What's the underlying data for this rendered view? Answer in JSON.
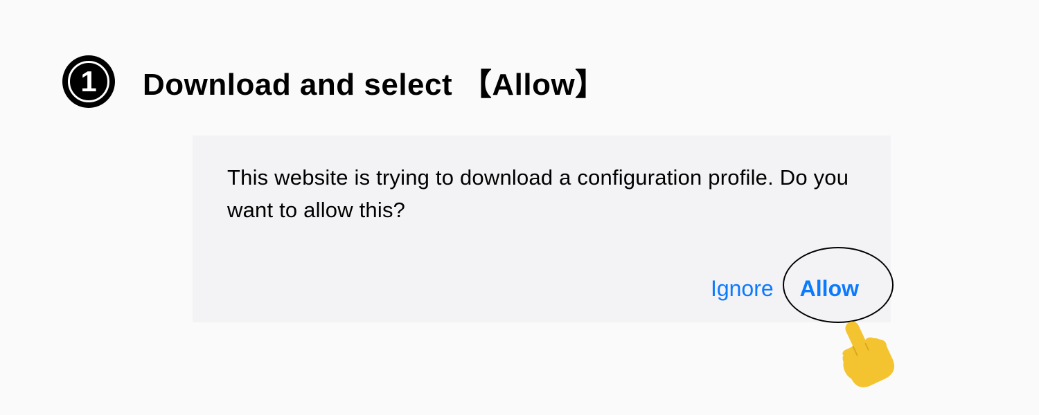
{
  "step": {
    "number": "1",
    "title": "Download and select 【Allow】"
  },
  "dialog": {
    "message": "This website is trying to download a configuration profile. Do you want to allow this?",
    "ignore_label": "Ignore",
    "allow_label": "Allow"
  }
}
